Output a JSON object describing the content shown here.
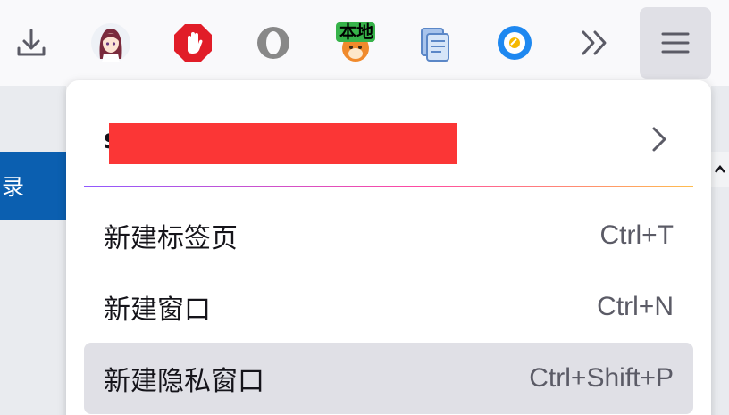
{
  "toolbar": {
    "extensions": [
      {
        "name": "download-icon"
      },
      {
        "name": "anime-avatar-extension-icon"
      },
      {
        "name": "adblock-hand-icon"
      },
      {
        "name": "ring-extension-icon"
      },
      {
        "name": "fox-local-extension-icon",
        "badge": "本地"
      },
      {
        "name": "documents-extension-icon"
      },
      {
        "name": "blue-circle-extension-icon"
      },
      {
        "name": "overflow-chevrons-icon"
      },
      {
        "name": "hamburger-menu-icon"
      }
    ]
  },
  "page": {
    "left_text": "录"
  },
  "menu": {
    "account_initial": "s",
    "items": [
      {
        "label": "新建标签页",
        "shortcut": "Ctrl+T"
      },
      {
        "label": "新建窗口",
        "shortcut": "Ctrl+N"
      },
      {
        "label": "新建隐私窗口",
        "shortcut": "Ctrl+Shift+P"
      }
    ]
  },
  "colors": {
    "accent_blue": "#0b5fb0",
    "redaction": "#fb3636",
    "hover_bg": "#e0e0e6"
  }
}
